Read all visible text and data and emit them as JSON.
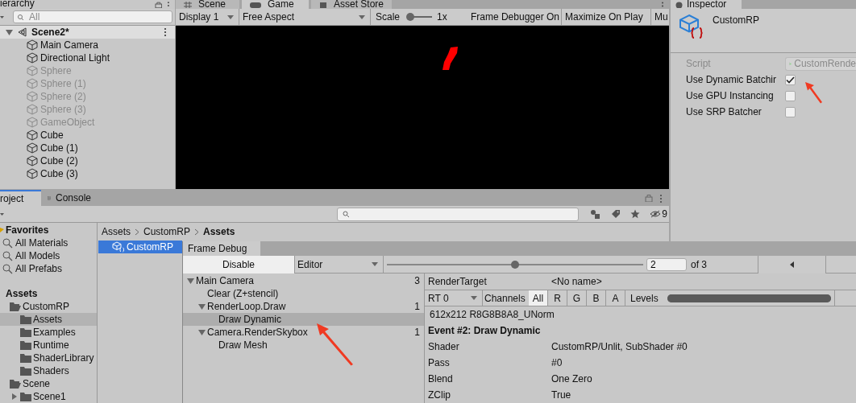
{
  "hierarchy": {
    "tab": "ierarchy",
    "search": {
      "placeholder": "All"
    },
    "scene": "Scene2*",
    "items": [
      {
        "label": "Main Camera",
        "active": true
      },
      {
        "label": "Directional Light",
        "active": true
      },
      {
        "label": "Sphere",
        "active": false
      },
      {
        "label": "Sphere (1)",
        "active": false
      },
      {
        "label": "Sphere (2)",
        "active": false
      },
      {
        "label": "Sphere (3)",
        "active": false
      },
      {
        "label": "GameObject",
        "active": false
      },
      {
        "label": "Cube",
        "active": true
      },
      {
        "label": "Cube (1)",
        "active": true
      },
      {
        "label": "Cube (2)",
        "active": true
      },
      {
        "label": "Cube (3)",
        "active": true
      }
    ]
  },
  "game": {
    "tabs": [
      {
        "label": "Scene",
        "kind": "scene",
        "selected": false
      },
      {
        "label": "Game",
        "kind": "game",
        "selected": true
      },
      {
        "label": "Asset Store",
        "kind": "store",
        "selected": false
      }
    ],
    "display": "Display 1",
    "aspect": "Free Aspect",
    "scale_label": "Scale",
    "scale": {
      "level": 0
    },
    "scale_value": "1x",
    "buttons": [
      "Frame Debugger On",
      "Maximize On Play",
      "Mu"
    ]
  },
  "inspector": {
    "tab": "Inspector",
    "title": "CustomRP",
    "script": {
      "label": "Script",
      "value": "CustomRende",
      "disabled": true
    },
    "options": [
      {
        "label": "Use Dynamic Batchir",
        "checked": true
      },
      {
        "label": "Use GPU Instancing",
        "checked": false
      },
      {
        "label": "Use SRP Batcher",
        "checked": false
      }
    ]
  },
  "project": {
    "tabs": [
      {
        "label": "roject",
        "kind": "project",
        "selected": true
      },
      {
        "label": "Console",
        "kind": "console",
        "selected": false
      }
    ],
    "hidden_count": "9",
    "favorites": {
      "label": "Favorites",
      "items": [
        "All Materials",
        "All Models",
        "All Prefabs"
      ]
    },
    "assets": {
      "label": "Assets",
      "children": [
        {
          "label": "CustomRP",
          "expanded": true,
          "selected": false,
          "children": [
            {
              "label": "Assets",
              "expanded": false,
              "selected": true
            },
            {
              "label": "Examples",
              "expanded": false,
              "selected": false
            },
            {
              "label": "Runtime",
              "expanded": false,
              "selected": false
            },
            {
              "label": "ShaderLibrary",
              "expanded": false,
              "selected": false
            },
            {
              "label": "Shaders",
              "expanded": false,
              "selected": false
            }
          ]
        },
        {
          "label": "Scene",
          "expanded": true,
          "selected": false,
          "children": [
            {
              "label": "Scene1",
              "expanded": false,
              "expandable": true,
              "selected": false
            }
          ]
        }
      ]
    },
    "breadcrumb": [
      "Assets",
      "CustomRP",
      "Assets"
    ],
    "files": [
      {
        "label": "CustomRP",
        "selected": true
      }
    ]
  },
  "frame_debug": {
    "title": "Frame Debug",
    "disable": "Disable",
    "mode": "Editor",
    "event": {
      "level": 0.5
    },
    "event_field": "2",
    "event_total": "of 3",
    "events": [
      {
        "label": "Main Camera",
        "count": "3",
        "expanded": true,
        "selected": false,
        "children": [
          {
            "label": "Clear (Z+stencil)",
            "selected": false
          },
          {
            "label": "RenderLoop.Draw",
            "count": "1",
            "expanded": true,
            "selected": false,
            "children": [
              {
                "label": "Draw Dynamic",
                "selected": true
              }
            ]
          },
          {
            "label": "Camera.RenderSkybox",
            "count": "1",
            "expanded": true,
            "selected": false,
            "children": [
              {
                "label": "Draw Mesh",
                "selected": false
              }
            ]
          }
        ]
      }
    ],
    "render_target": {
      "label": "RenderTarget",
      "value": "<No name>"
    },
    "rt": "RT 0",
    "channels_label": "Channels",
    "channels": [
      {
        "label": "All",
        "selected": true
      },
      {
        "label": "R",
        "selected": false
      },
      {
        "label": "G",
        "selected": false
      },
      {
        "label": "B",
        "selected": false
      },
      {
        "label": "A",
        "selected": false
      }
    ],
    "levels_label": "Levels",
    "levels": {
      "level": 1
    },
    "format": "612x212 R8G8B8A8_UNorm",
    "event_title": "Event #2: Draw Dynamic",
    "properties": [
      {
        "name": "Shader",
        "value": "CustomRP/Unlit, SubShader #0"
      },
      {
        "name": "Pass",
        "value": "#0"
      },
      {
        "name": "Blend",
        "value": "One Zero"
      },
      {
        "name": "ZClip",
        "value": "True"
      }
    ]
  }
}
